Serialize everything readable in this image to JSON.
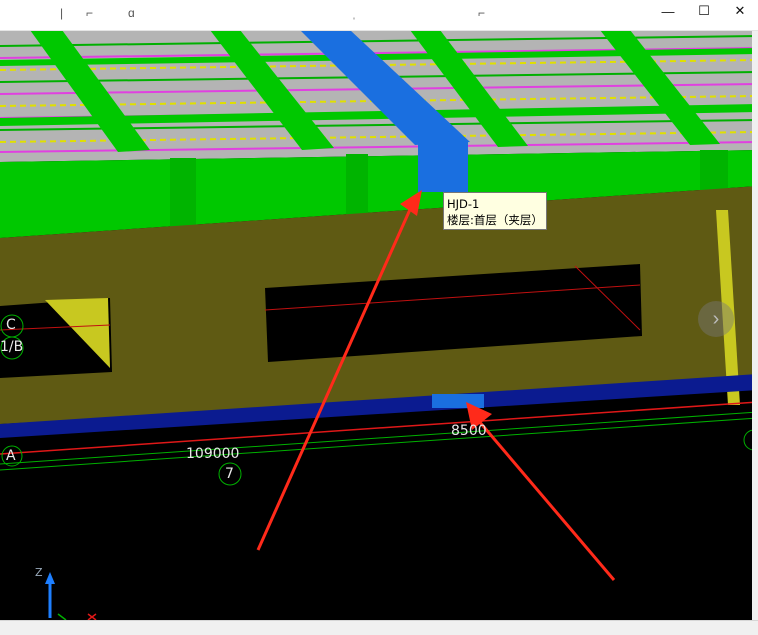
{
  "window": {
    "minimize_glyph": "—",
    "maximize_glyph": "☐",
    "close_glyph": "✕"
  },
  "tooltip": {
    "line1": "HJD-1",
    "line2": "楼层:首层（夹层）"
  },
  "axis_labels": {
    "c": "C",
    "one_b": "1/B",
    "a": "A",
    "dim_left": "109000",
    "dim_right": "8500",
    "grid_7": "7"
  },
  "gizmo": {
    "z": "Z"
  },
  "colors": {
    "slab_green": "#00c800",
    "wall_olive": "#5f5a13",
    "hidden_beam_blue": "#1a6fe0",
    "axis_blue": "#0b1b90",
    "arrow_red": "#ff2a1a"
  }
}
